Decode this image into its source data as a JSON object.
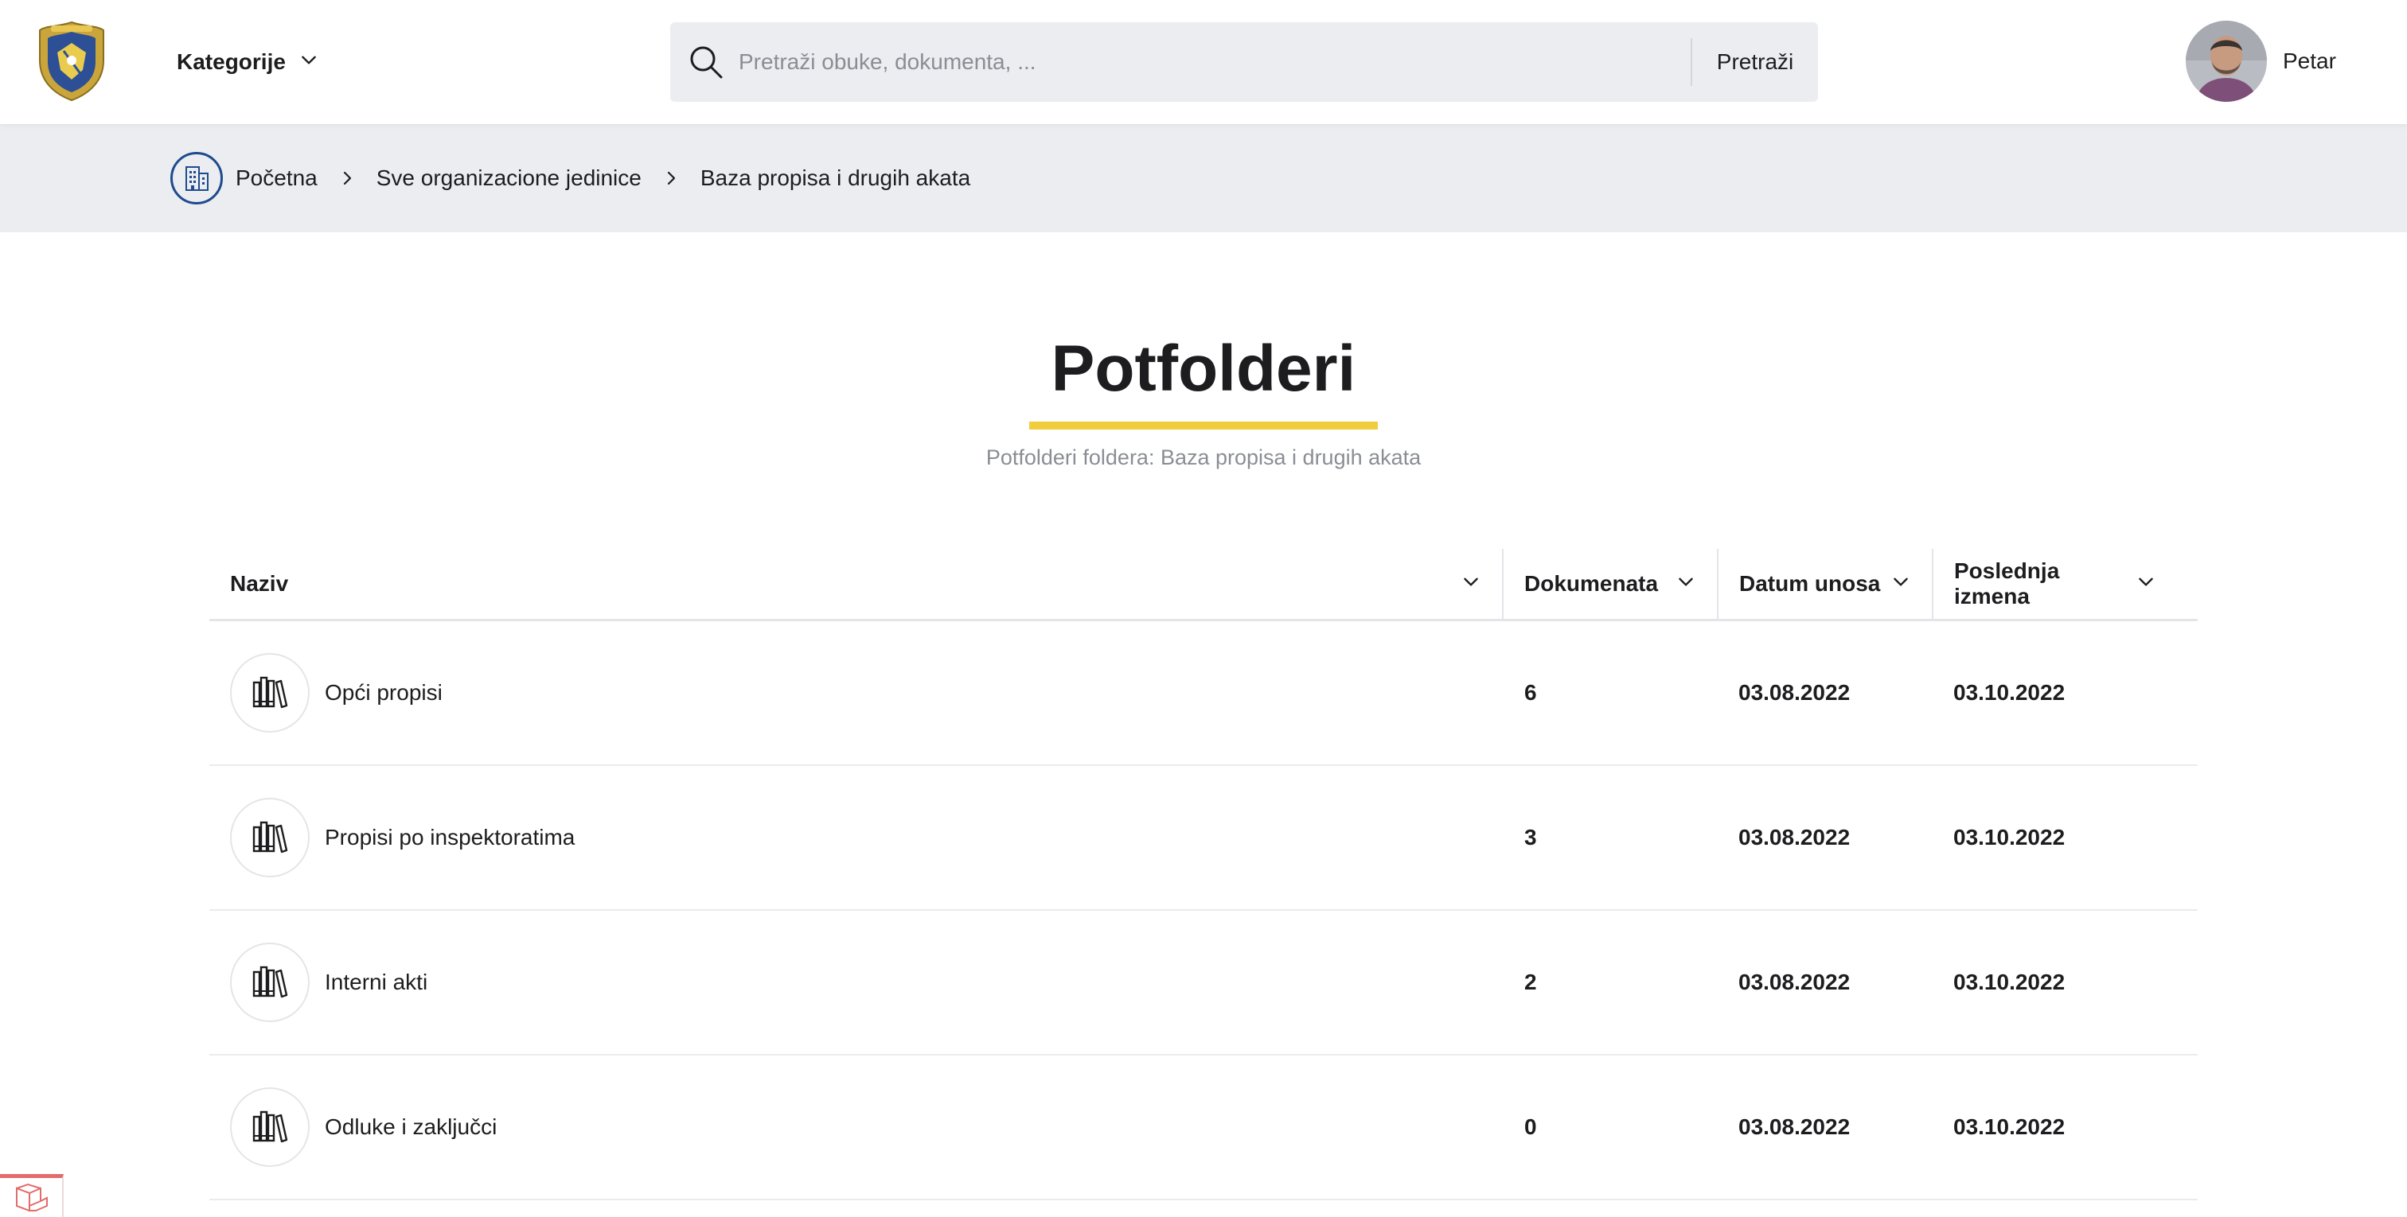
{
  "header": {
    "categories_label": "Kategorije",
    "search": {
      "placeholder": "Pretraži obuke, dokumenta, ...",
      "button_label": "Pretraži"
    },
    "user": {
      "name": "Petar"
    }
  },
  "breadcrumb": {
    "items": [
      {
        "label": "Početna"
      },
      {
        "label": "Sve organizacione jedinice"
      },
      {
        "label": "Baza propisa i drugih akata"
      }
    ]
  },
  "page": {
    "title": "Potfolderi",
    "subtitle": "Potfolderi foldera: Baza propisa i drugih akata",
    "accent_color": "#f0cd3d"
  },
  "table": {
    "columns": [
      {
        "label": "Naziv"
      },
      {
        "label": "Dokumenata"
      },
      {
        "label": "Datum unosa"
      },
      {
        "label": "Poslednja izmena"
      }
    ],
    "rows": [
      {
        "icon": "books-icon",
        "name": "Opći propisi",
        "documents": "6",
        "created": "03.08.2022",
        "modified": "03.10.2022"
      },
      {
        "icon": "books-icon",
        "name": "Propisi po inspektoratima",
        "documents": "3",
        "created": "03.08.2022",
        "modified": "03.10.2022"
      },
      {
        "icon": "books-icon",
        "name": "Interni akti",
        "documents": "2",
        "created": "03.08.2022",
        "modified": "03.10.2022"
      },
      {
        "icon": "books-icon",
        "name": "Odluke i zaključci",
        "documents": "0",
        "created": "03.08.2022",
        "modified": "03.10.2022"
      }
    ]
  }
}
